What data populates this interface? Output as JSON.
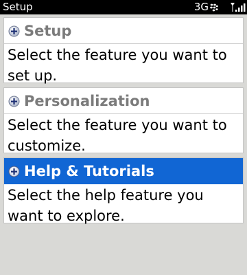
{
  "status_bar": {
    "title": "Setup",
    "network": "3G",
    "icons": [
      "blackberry-logo-icon",
      "signal-strength-icon"
    ]
  },
  "cards": [
    {
      "title": "Setup",
      "description": "Select the feature you want to set up.",
      "icon": "expand-plus-icon",
      "selected": false
    },
    {
      "title": "Personalization",
      "description": "Select the feature you want to customize.",
      "icon": "expand-plus-icon",
      "selected": false
    },
    {
      "title": "Help & Tutorials",
      "description": "Select the help feature you want to explore.",
      "icon": "expand-plus-icon",
      "selected": true
    }
  ],
  "colors": {
    "selection_blue": "#1166d4",
    "header_text_gray": "#7b7b7b",
    "background": "#d9d9d6"
  }
}
